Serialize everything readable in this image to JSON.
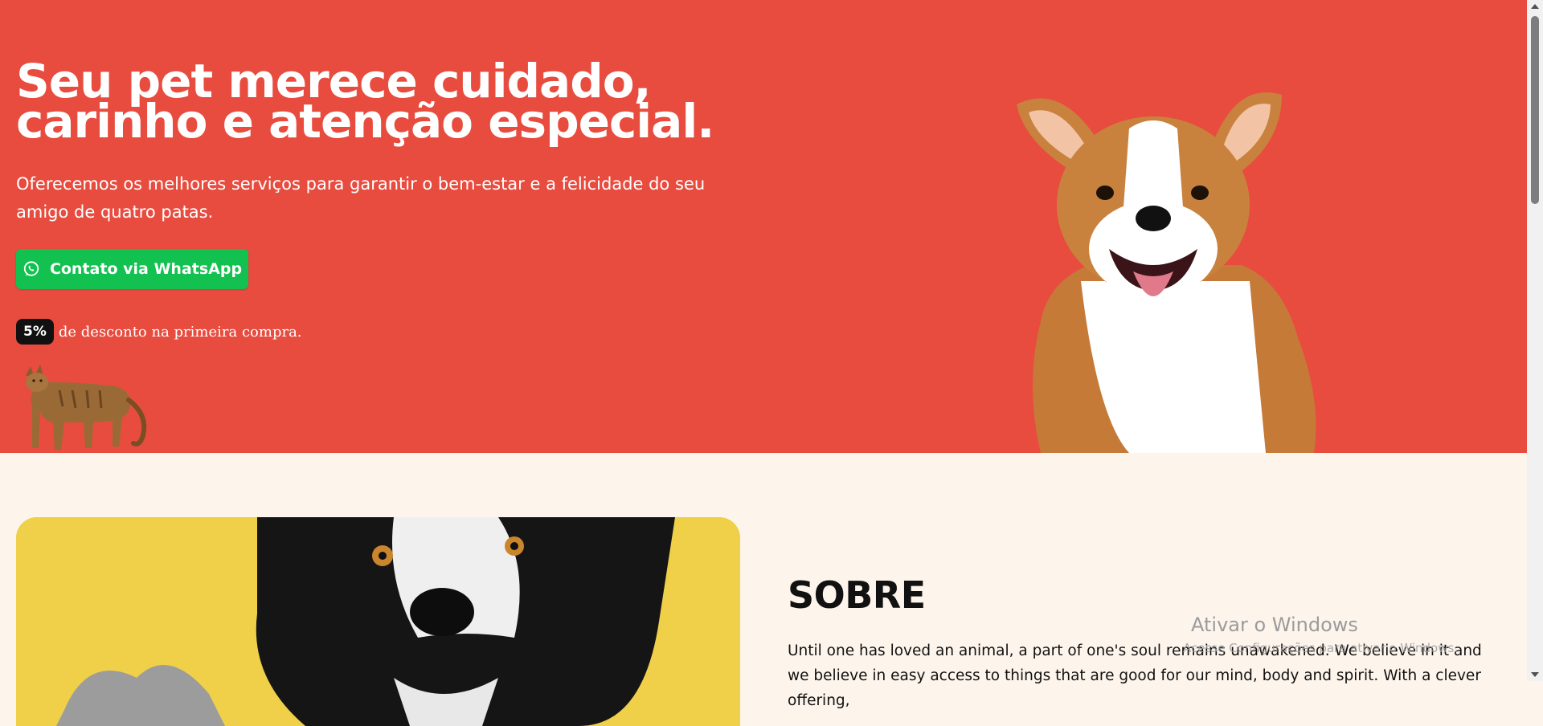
{
  "hero": {
    "title_line1": "Seu pet merece cuidado,",
    "title_line2": "carinho e atenção especial.",
    "subtitle": "Oferecemos os melhores serviços para garantir o bem-estar e a felicidade do seu amigo de quatro patas.",
    "cta_label": "Contato via WhatsApp",
    "cta_icon": "whatsapp-icon",
    "discount_badge": "5%",
    "discount_text": "de desconto na primeira compra.",
    "background_color": "#e74c3f",
    "cta_color": "#12c150"
  },
  "about": {
    "title": "SOBRE",
    "text": "Until one has loved an animal, a part of one's soul remains unawakened. We believe in it and we believe in easy access to things that are good for our mind, body and spirit. With a clever offering,"
  },
  "watermark": {
    "title": "Ativar o Windows",
    "subtitle": "Acesse Configurações para ativar o Windows."
  }
}
